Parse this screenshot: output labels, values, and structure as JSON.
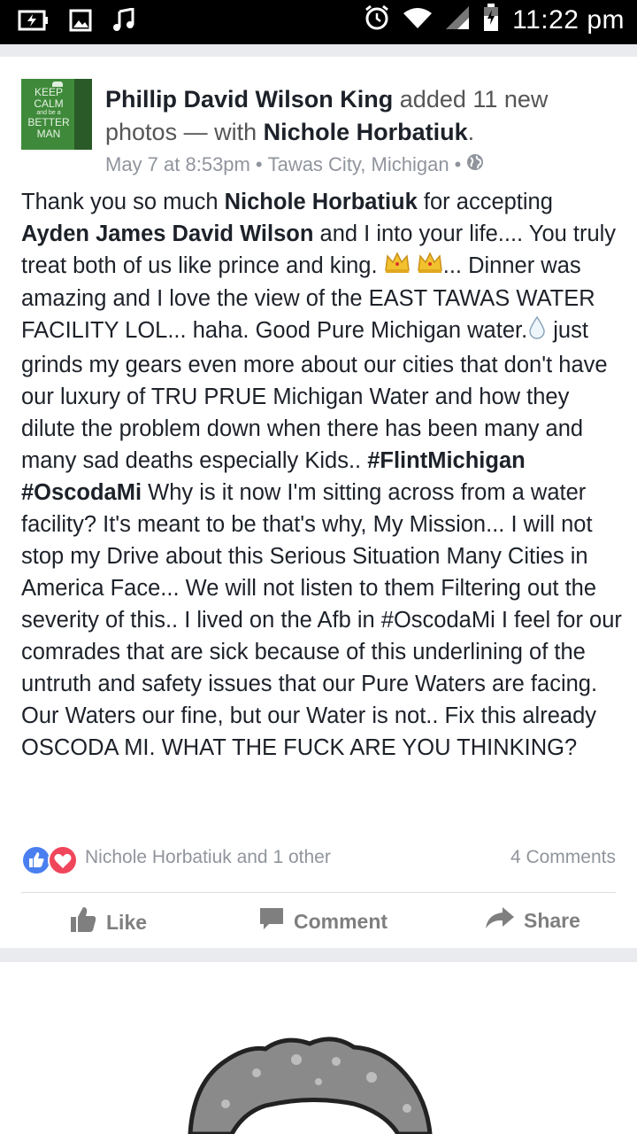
{
  "status_bar": {
    "time": "11:22 pm",
    "left_icons": [
      "battery-charging-icon",
      "image-icon",
      "music-note-icon"
    ],
    "right_icons": [
      "alarm-icon",
      "wifi-icon",
      "cell-signal-icon",
      "battery-icon"
    ]
  },
  "post": {
    "avatar_text": {
      "line1": "KEEP",
      "line2": "CALM",
      "line3": "and be a",
      "line4": "BETTER",
      "line5": "MAN"
    },
    "author": "Phillip David Wilson King",
    "action_text": "added 11 new photos — with",
    "tagged": "Nichole Horbatiuk",
    "date": "May 7 at 8:53pm",
    "separator": "•",
    "location": "Tawas City, Michigan",
    "privacy_icon": "globe-icon",
    "body": {
      "p1": "Thank you so much ",
      "m1": "Nichole Horbatiuk",
      "p2": " for accepting ",
      "m2": "Ayden James David Wilson",
      "p3": " and I into your life.... You truly treat both of us like prince and king. ",
      "p4": "... Dinner was amazing and I love the view of the EAST TAWAS WATER FACILITY LOL...  haha.  Good Pure Michigan water.",
      "p5": " just grinds my gears even more about our cities that don't have our luxury of TRU PRUE Michigan Water and how they dilute the problem down when there has been many and many sad deaths especially Kids..  ",
      "h1": "#FlintMichigan",
      "h2": "#OscodaMi",
      "p6": " Why is it now I'm sitting across from a water facility?  It's meant to be that's why, My Mission...  I will not stop my Drive about this Serious Situation Many Cities in America Face... We will not listen to them Filtering out the severity of this..  I lived on the Afb in #OscodaMi I feel for our comrades that are sick because of  this underlining of the untruth and safety issues that our Pure Waters are facing.  Our Waters our fine, but our Water is not..  Fix this already OSCODA MI.  WHAT THE FUCK ARE YOU THINKING?"
    },
    "reactions": {
      "names": "Nichole Horbatiuk and 1 other",
      "comments": "4 Comments"
    },
    "actions": {
      "like": "Like",
      "comment": "Comment",
      "share": "Share"
    },
    "colors": {
      "like_blue": "#4a7ff0",
      "love_red": "#f0465b",
      "avatar_green": "#3f8a3a"
    }
  }
}
